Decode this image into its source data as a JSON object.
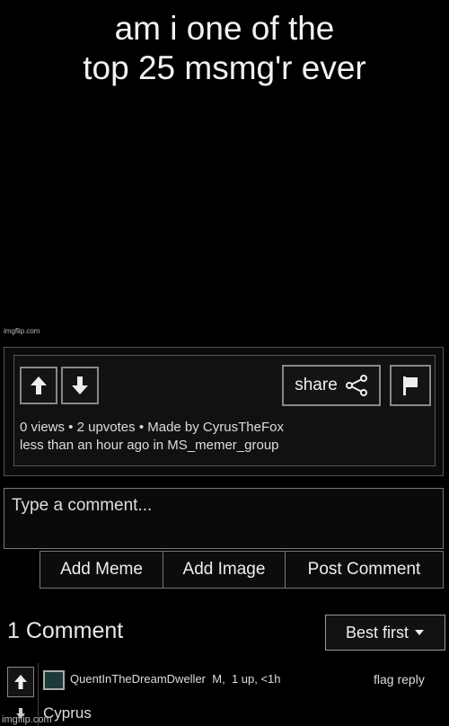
{
  "meme": {
    "line1": "am i one of the",
    "line2": "top 25 msmg'r ever",
    "watermark": "imgflip.com"
  },
  "post": {
    "share_label": "share",
    "meta_line1": "0 views • 2 upvotes • Made by CyrusTheFox",
    "meta_line2": "less than an hour ago in MS_memer_group",
    "upvote_icon": "up-arrow-icon",
    "downvote_icon": "down-arrow-icon",
    "flag_icon": "flag-icon"
  },
  "comment_form": {
    "placeholder": "Type a comment...",
    "add_meme": "Add Meme",
    "add_image": "Add Image",
    "post_comment": "Post Comment"
  },
  "comments": {
    "count_label": "1 Comment",
    "sort_label": "Best first",
    "items": [
      {
        "user": "QuentInTheDreamDweller",
        "badge": "M",
        "stats": "1 up, <1h",
        "flag_label": "flag",
        "reply_label": "reply",
        "text": "Cyprus"
      }
    ]
  },
  "footer": {
    "watermark": "imgflip.com"
  }
}
